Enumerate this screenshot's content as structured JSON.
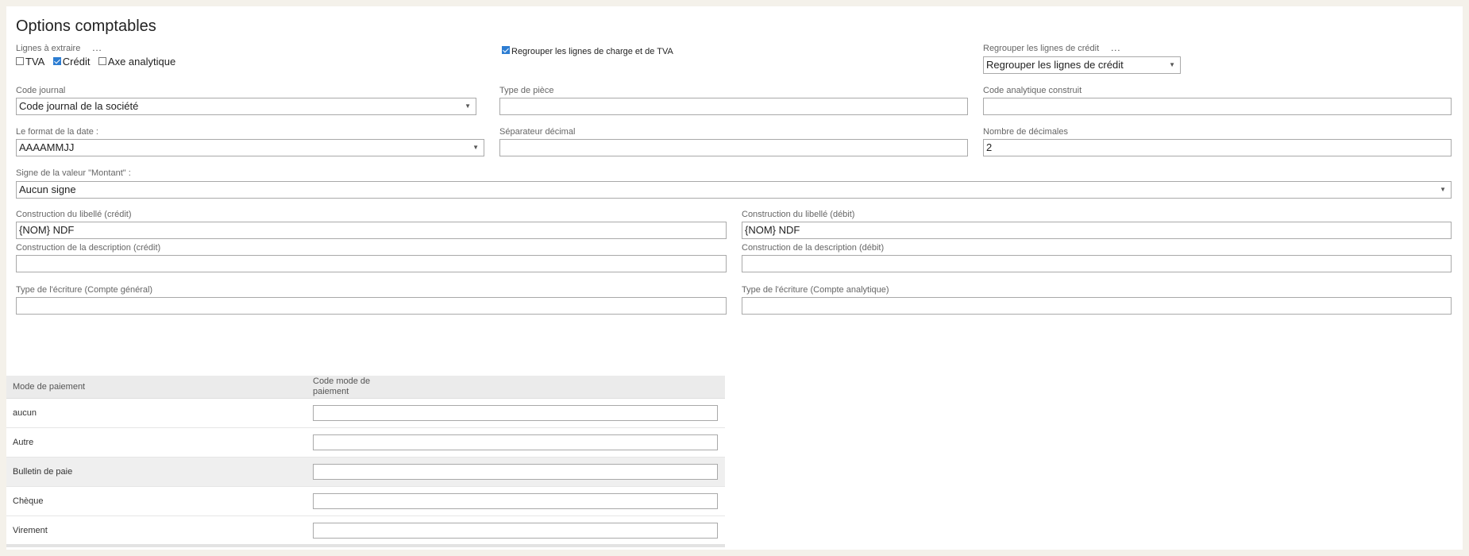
{
  "page": {
    "title": "Options comptables"
  },
  "extract": {
    "label": "Lignes à extraire",
    "more": "...",
    "options": [
      {
        "label": "TVA",
        "checked": false
      },
      {
        "label": "Crédit",
        "checked": true
      },
      {
        "label": "Axe analytique",
        "checked": false
      }
    ]
  },
  "group_charge_vat": {
    "label": "Regrouper les lignes de charge et de TVA",
    "checked": true
  },
  "group_credit": {
    "label": "Regrouper les lignes de crédit",
    "more": "...",
    "value": "Regrouper les lignes de crédit"
  },
  "journal_code": {
    "label": "Code journal",
    "value": "Code journal de la société"
  },
  "piece_type": {
    "label": "Type de pièce",
    "value": ""
  },
  "analytic_code": {
    "label": "Code analytique construit",
    "value": ""
  },
  "date_format": {
    "label": "Le format de la date :",
    "value": "AAAAMMJJ"
  },
  "decimal_separator": {
    "label": "Séparateur décimal",
    "value": ""
  },
  "decimals": {
    "label": "Nombre de décimales",
    "value": "2"
  },
  "amount_sign": {
    "label": "Signe de la valeur \"Montant\" :",
    "value": "Aucun signe"
  },
  "label_credit": {
    "label": "Construction du libellé (crédit)",
    "value": "{NOM} NDF"
  },
  "label_debit": {
    "label": "Construction du libellé (débit)",
    "value": "{NOM} NDF"
  },
  "desc_credit": {
    "label": "Construction de la description (crédit)",
    "value": ""
  },
  "desc_debit": {
    "label": "Construction de la description (débit)",
    "value": ""
  },
  "entry_type_general": {
    "label": "Type de l'écriture (Compte général)",
    "value": ""
  },
  "entry_type_analytic": {
    "label": "Type de l'écriture (Compte analytique)",
    "value": ""
  },
  "payment_table": {
    "headers": [
      "Mode de paiement",
      "Code mode de paiement"
    ],
    "rows": [
      {
        "mode": "aucun",
        "code": ""
      },
      {
        "mode": "Autre",
        "code": ""
      },
      {
        "mode": "Bulletin de paie",
        "code": "",
        "highlighted": true
      },
      {
        "mode": "Chèque",
        "code": ""
      },
      {
        "mode": "Virement",
        "code": ""
      }
    ]
  }
}
